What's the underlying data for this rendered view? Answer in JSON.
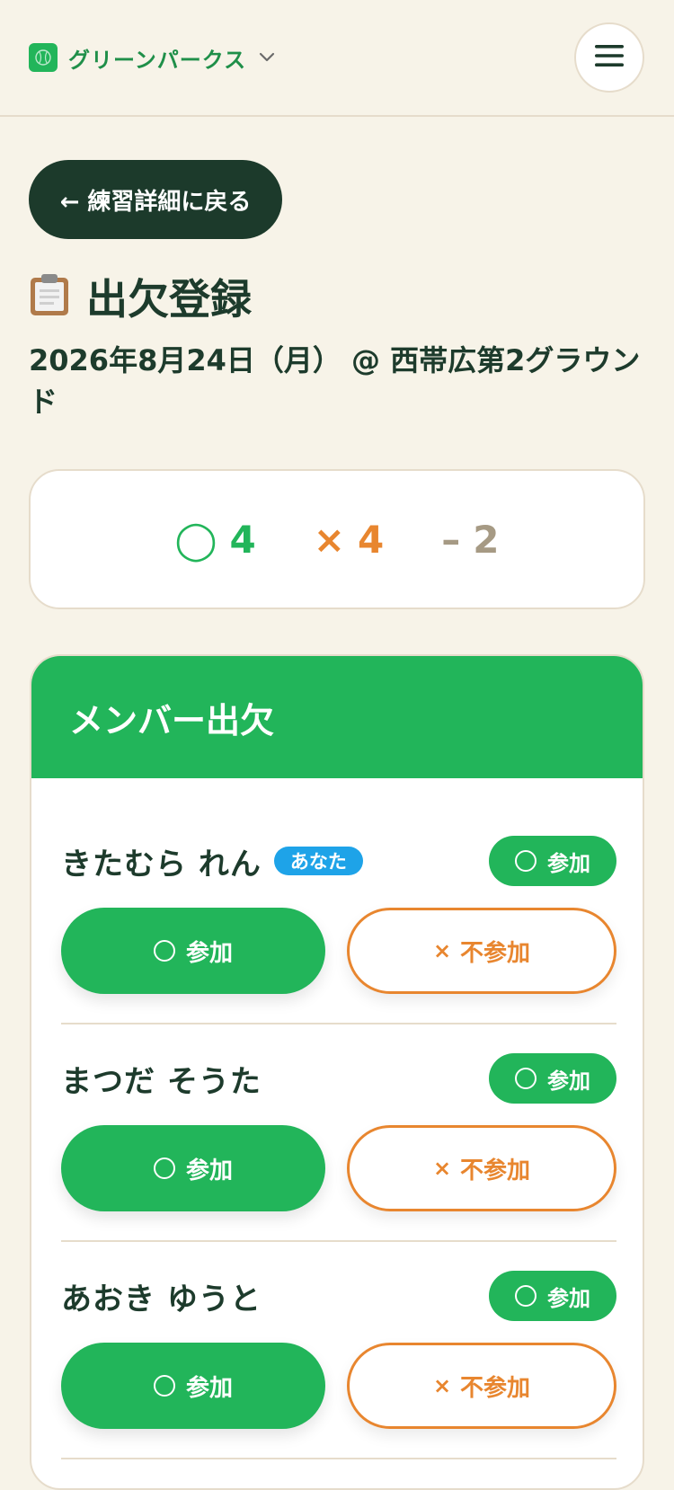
{
  "header": {
    "team_name": "グリーンパークス",
    "team_logo_icon": "baseball-icon",
    "menu_icon": "hamburger-menu-icon"
  },
  "back_button": {
    "label": "← 練習詳細に戻る"
  },
  "page": {
    "title_icon": "clipboard-icon",
    "title": "出欠登録",
    "subtitle": "2026年8月24日（月） @ 西帯広第2グラウンド"
  },
  "summary": {
    "attend_symbol": "◯",
    "attend_count": "4",
    "absent_symbol": "×",
    "absent_count": "4",
    "undecided_symbol": "–",
    "undecided_count": "2"
  },
  "members_section": {
    "heading": "メンバー出欠",
    "attend_button_label": "参加",
    "absent_button_label": "不参加",
    "items": [
      {
        "name": "きたむら れん",
        "you_badge": "あなた",
        "status": "参加"
      },
      {
        "name": "まつだ そうた",
        "you_badge": "",
        "status": "参加"
      },
      {
        "name": "あおき ゆうと",
        "you_badge": "",
        "status": "参加"
      }
    ]
  },
  "colors": {
    "accent_green": "#22b55a",
    "dark_green": "#1c3a2b",
    "orange": "#e8862f",
    "badge_blue": "#1ea3e8",
    "background": "#f7f3e8"
  }
}
